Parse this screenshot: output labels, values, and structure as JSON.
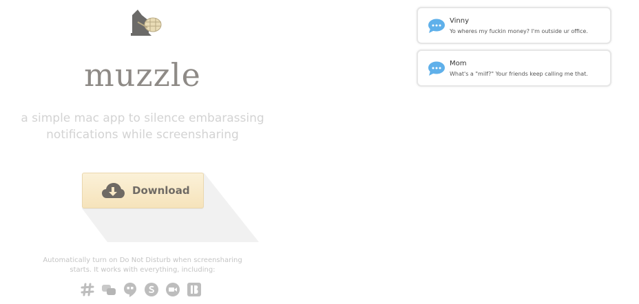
{
  "hero": {
    "wordmark": "muzzle",
    "tagline": "a simple mac app to silence embarassing notifications while screensharing",
    "logo_icon": "muzzled-dog-icon"
  },
  "download": {
    "label": "Download",
    "icon": "cloud-download-icon"
  },
  "footnote": "Automatically turn on Do Not Disturb when screensharing starts. It works with everything, including:",
  "apps": [
    {
      "icon": "slack-icon"
    },
    {
      "icon": "gotomeeting-icon"
    },
    {
      "icon": "hangouts-icon"
    },
    {
      "icon": "skype-icon"
    },
    {
      "icon": "facetime-icon"
    },
    {
      "icon": "bluejeans-icon"
    }
  ],
  "notifications": [
    {
      "sender": "Vinny",
      "message": "Yo wheres my fuckin money? I'm outside ur office.",
      "icon": "messages-icon"
    },
    {
      "sender": "Mom",
      "message": "What's a \"milf?\" Your friends keep calling me that.",
      "icon": "messages-icon"
    }
  ],
  "colors": {
    "button_top": "#fbf1d8",
    "button_bottom": "#f6e3bb",
    "wordmark": "#8e8a86",
    "tagline": "#d3d3d3",
    "messages_blue": "#5fb0ea"
  }
}
